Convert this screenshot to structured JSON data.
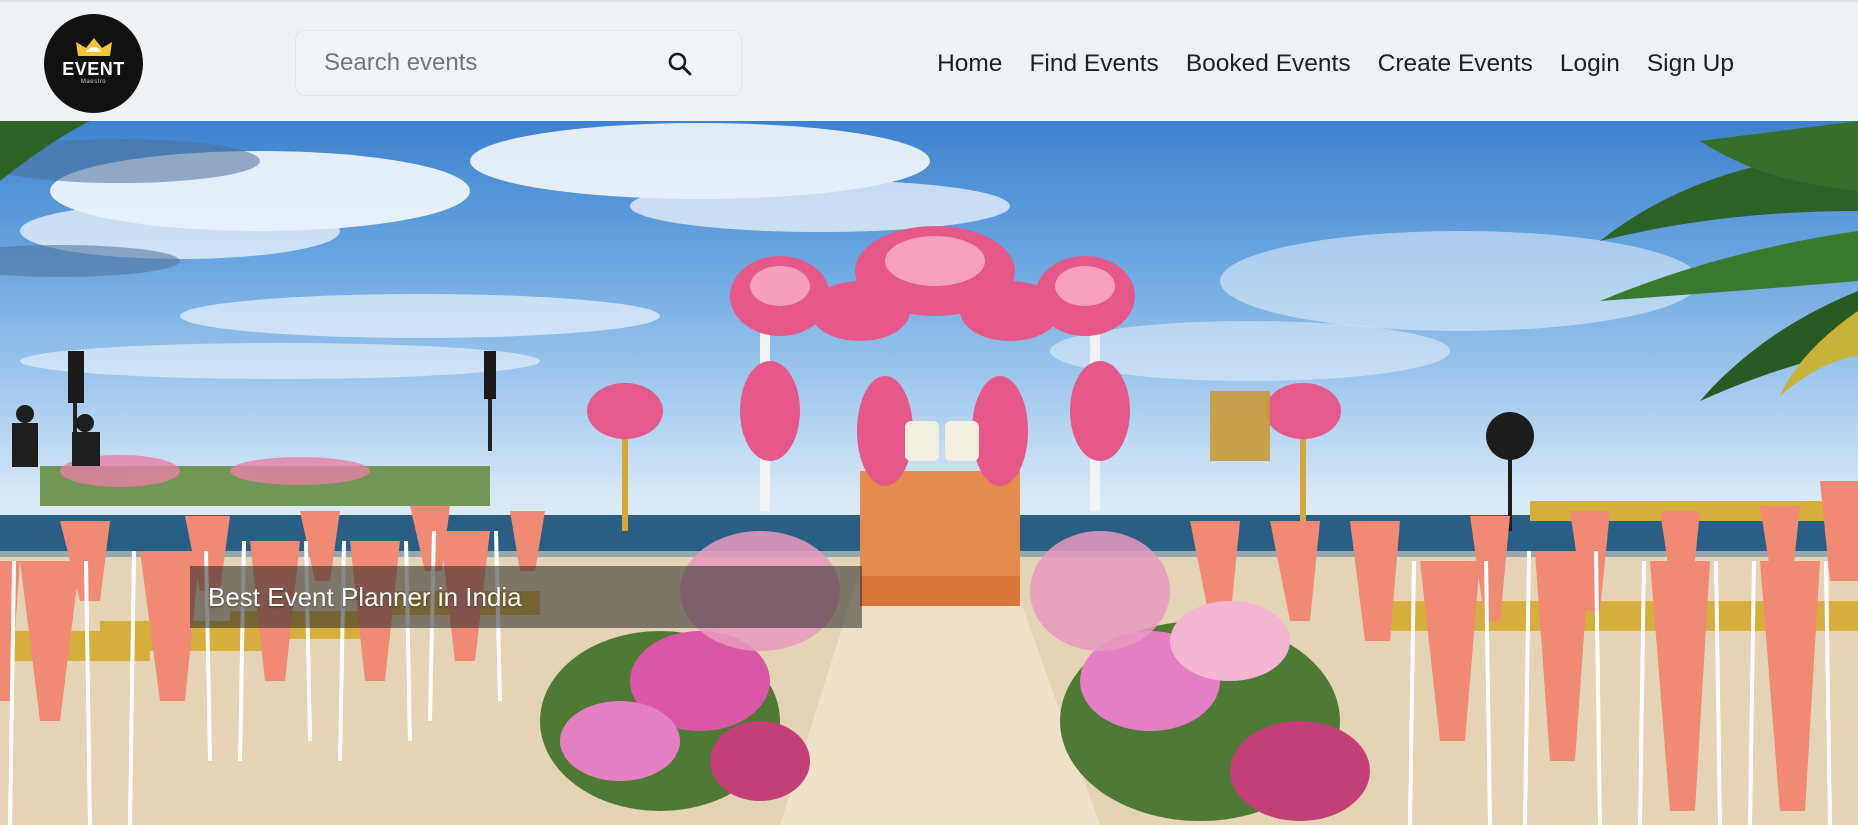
{
  "brand": {
    "name": "EVENT",
    "tagline": "Maestro"
  },
  "search": {
    "placeholder": "Search events",
    "icon": "search-icon"
  },
  "nav": {
    "items": [
      {
        "label": "Home"
      },
      {
        "label": "Find Events"
      },
      {
        "label": "Booked Events"
      },
      {
        "label": "Create Events"
      },
      {
        "label": "Login"
      },
      {
        "label": "Sign Up"
      }
    ]
  },
  "hero": {
    "caption": "Best Event Planner in India",
    "image": "beach-wedding-floral-mandap"
  },
  "colors": {
    "navbar_bg": "#eef2f5",
    "logo_bg": "#111111",
    "logo_crown": "#f2c631",
    "nav_text": "#1e2023",
    "chair_sash": "#f08a74",
    "flowers": "#e6578a"
  }
}
